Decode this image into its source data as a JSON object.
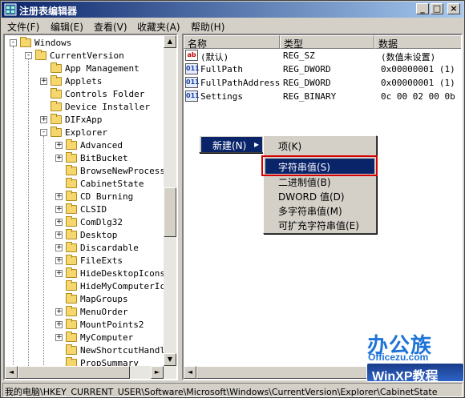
{
  "window": {
    "title": "注册表编辑器",
    "min": "_",
    "max": "□",
    "close": "×"
  },
  "menu": [
    "文件(F)",
    "编辑(E)",
    "查看(V)",
    "收藏夹(A)",
    "帮助(H)"
  ],
  "tree": [
    {
      "label": "Windows",
      "exp": "-"
    },
    {
      "label": "CurrentVersion",
      "exp": "-"
    },
    {
      "label": "App Management",
      "exp": ""
    },
    {
      "label": "Applets",
      "exp": "+"
    },
    {
      "label": "Controls Folder",
      "exp": ""
    },
    {
      "label": "Device Installer",
      "exp": ""
    },
    {
      "label": "DIFxApp",
      "exp": "+"
    },
    {
      "label": "Explorer",
      "exp": "-"
    },
    {
      "label": "Advanced",
      "exp": "+"
    },
    {
      "label": "BitBucket",
      "exp": "+"
    },
    {
      "label": "BrowseNewProcess",
      "exp": ""
    },
    {
      "label": "CabinetState",
      "exp": ""
    },
    {
      "label": "CD Burning",
      "exp": "+"
    },
    {
      "label": "CLSID",
      "exp": "+"
    },
    {
      "label": "ComDlg32",
      "exp": "+"
    },
    {
      "label": "Desktop",
      "exp": "+"
    },
    {
      "label": "Discardable",
      "exp": "+"
    },
    {
      "label": "FileExts",
      "exp": "+"
    },
    {
      "label": "HideDesktopIcons",
      "exp": "+"
    },
    {
      "label": "HideMyComputerIcons",
      "exp": ""
    },
    {
      "label": "MapGroups",
      "exp": ""
    },
    {
      "label": "MenuOrder",
      "exp": "+"
    },
    {
      "label": "MountPoints2",
      "exp": "+"
    },
    {
      "label": "MyComputer",
      "exp": "+"
    },
    {
      "label": "NewShortcutHandlers",
      "exp": ""
    },
    {
      "label": "PropSummary",
      "exp": ""
    }
  ],
  "list": {
    "headers": [
      "名称",
      "类型",
      "数据"
    ],
    "rows": [
      {
        "icon": "ab",
        "name": "(默认)",
        "type": "REG_SZ",
        "data": "(数值未设置)"
      },
      {
        "icon": "011",
        "name": "FullPath",
        "type": "REG_DWORD",
        "data": "0x00000001 (1)"
      },
      {
        "icon": "011",
        "name": "FullPathAddress",
        "type": "REG_DWORD",
        "data": "0x00000001 (1)"
      },
      {
        "icon": "011",
        "name": "Settings",
        "type": "REG_BINARY",
        "data": "0c 00 02 00 0b 01"
      }
    ]
  },
  "context_menu": {
    "new_label": "新建(N)",
    "arrow": "▸"
  },
  "submenu": [
    "项(K)",
    "字符串值(S)",
    "二进制值(B)",
    "DWORD 值(D)",
    "多字符串值(M)",
    "可扩充字符串值(E)"
  ],
  "status": "我的电脑\\HKEY_CURRENT_USER\\Software\\Microsoft\\Windows\\CurrentVersion\\Explorer\\CabinetState",
  "watermark": {
    "brand": "办公族",
    "site": "Officezu.com",
    "badge": "WinXP教程"
  },
  "scroll": {
    "up": "▲",
    "down": "▼",
    "left": "◄",
    "right": "►"
  }
}
